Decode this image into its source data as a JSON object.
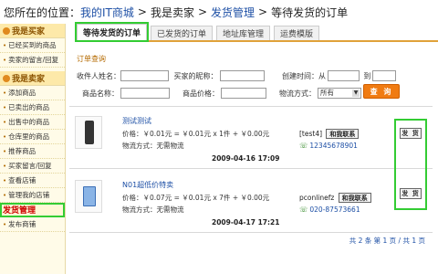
{
  "breadcrumb": {
    "prefix": "您所在的位置：",
    "items": [
      "我的IT商城",
      "我是卖家",
      "发货管理",
      "等待发货的订单"
    ],
    "separator": ">"
  },
  "sidebar": {
    "buyer_section": "我是买家",
    "buyer_items": [
      "已经买到的商品",
      "卖家的留言/回复"
    ],
    "seller_section": "我是卖家",
    "seller_items": [
      "添加商品",
      "已卖出的商品",
      "出售中的商品",
      "仓库里的商品",
      "推荐商品",
      "买家留言/回复",
      "查看店铺",
      "管理我的店铺",
      "发货管理",
      "发布商铺"
    ],
    "active_item": "发货管理"
  },
  "tabs": [
    {
      "label": "等待发货的订单",
      "active": true
    },
    {
      "label": "已发货的订单",
      "active": false
    },
    {
      "label": "地址库管理",
      "active": false
    },
    {
      "label": "运费模版",
      "active": false
    }
  ],
  "query": {
    "title": "订单查询",
    "recipient_label": "收件人姓名：",
    "buyer_nick_label": "买家的昵称：",
    "created_label": "创建时间：从",
    "to_label": "到",
    "product_name_label": "商品名称：",
    "product_price_label": "商品价格：",
    "ship_method_label": "物流方式：",
    "ship_method_value": "所有",
    "submit_label": "查 询"
  },
  "orders": [
    {
      "name": "测试测试",
      "price": "价格：￥0.01元 = ￥0.01元 x 1件 + ￥0.00元",
      "ship": "物流方式：无需物流",
      "time": "2009-04-16 17:09",
      "buyer": "[test4]",
      "contact_label": "和我联系",
      "phone": "12345678901",
      "ship_button": "发 货"
    },
    {
      "name": "N01超低价特卖",
      "price": "价格：￥0.07元 = ￥0.01元 x 7件 + ￥0.00元",
      "ship": "物流方式：无需物流",
      "time": "2009-04-17 17:21",
      "buyer": "pconlinefz",
      "contact_label": "和我联系",
      "phone": "020-87573661",
      "ship_button": "发 货"
    }
  ],
  "pager": "共 2 条 第 1 页 / 共 1 页"
}
